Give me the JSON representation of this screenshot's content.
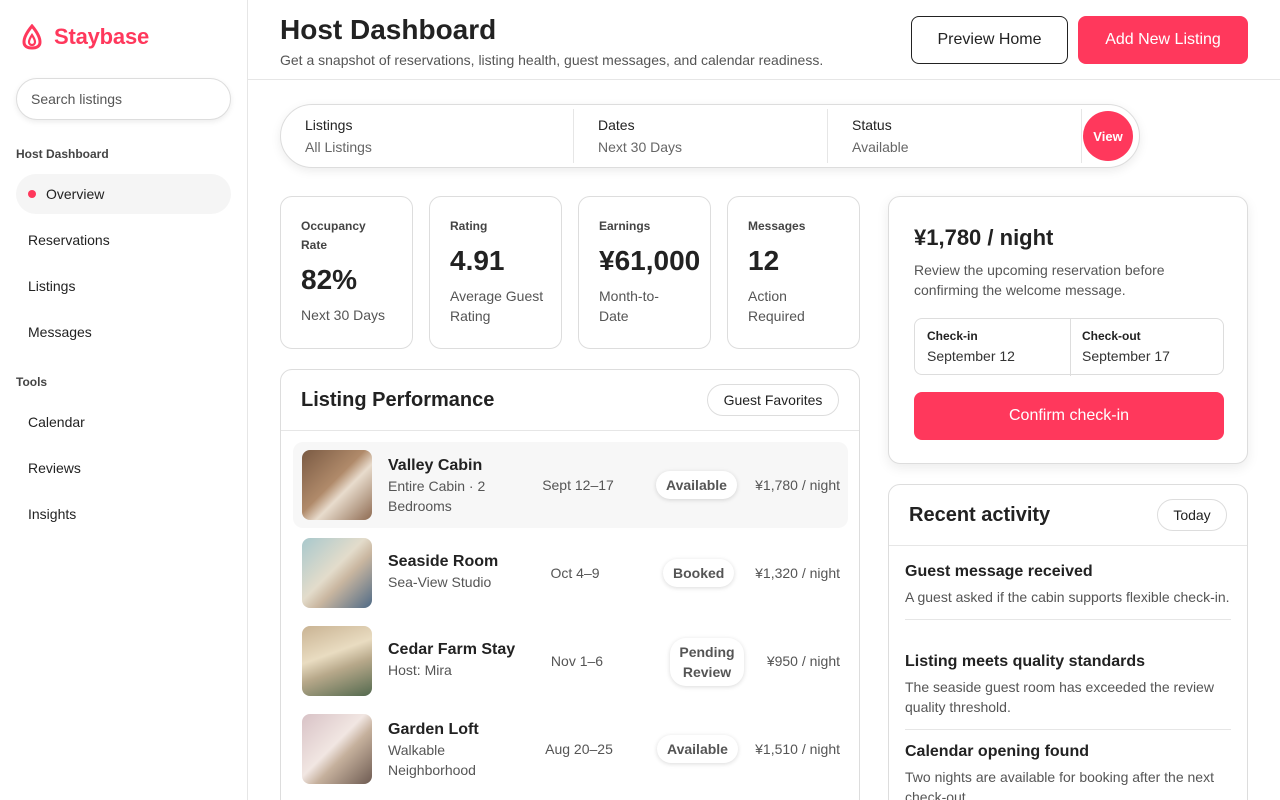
{
  "brand": {
    "name": "Staybase",
    "logo_icon": "staybase-logo-icon",
    "color": "#ff385c"
  },
  "search": {
    "placeholder": "Search listings"
  },
  "sidebar": {
    "sections": [
      {
        "heading": "Host Dashboard",
        "items": [
          {
            "label": "Overview",
            "active": true
          },
          {
            "label": "Reservations"
          },
          {
            "label": "Listings"
          },
          {
            "label": "Messages"
          }
        ]
      },
      {
        "heading": "Tools",
        "items": [
          {
            "label": "Calendar"
          },
          {
            "label": "Reviews"
          },
          {
            "label": "Insights"
          }
        ]
      }
    ]
  },
  "header": {
    "title": "Host Dashboard",
    "subtitle": "Get a snapshot of reservations, listing health, guest messages, and calendar readiness.",
    "preview_label": "Preview Home",
    "add_label": "Add New Listing"
  },
  "filters": {
    "listings": {
      "label": "Listings",
      "value": "All Listings"
    },
    "dates": {
      "label": "Dates",
      "value": "Next 30 Days"
    },
    "status": {
      "label": "Status",
      "value": "Available"
    },
    "view_label": "View"
  },
  "stats": [
    {
      "label": "Occupancy Rate",
      "value": "82%",
      "sub": "Next 30 Days"
    },
    {
      "label": "Rating",
      "value": "4.91",
      "sub": "Average Guest Rating"
    },
    {
      "label": "Earnings",
      "value": "¥61,000",
      "sub": "Month-to-Date"
    },
    {
      "label": "Messages",
      "value": "12",
      "sub": "Action Required"
    }
  ],
  "performance": {
    "title": "Listing Performance",
    "filter_label": "Guest Favorites",
    "listings": [
      {
        "name": "Valley Cabin",
        "sub": "Entire Cabin · 2 Bedrooms",
        "dates": "Sept 12–17",
        "status": "Available",
        "price": "¥1,780 / night"
      },
      {
        "name": "Seaside Room",
        "sub": "Sea-View Studio",
        "dates": "Oct 4–9",
        "status": "Booked",
        "price": "¥1,320 / night"
      },
      {
        "name": "Cedar Farm Stay",
        "sub": "Host: Mira",
        "dates": "Nov 1–6",
        "status": "Pending Review",
        "price": "¥950 / night"
      },
      {
        "name": "Garden Loft",
        "sub": "Walkable Neighborhood",
        "dates": "Aug 20–25",
        "status": "Available",
        "price": "¥1,510 / night"
      }
    ]
  },
  "booking": {
    "price": "¥1,780 / night",
    "description": "Review the upcoming reservation before confirming the welcome message.",
    "checkin_label": "Check-in",
    "checkin_value": "September 12",
    "checkout_label": "Check-out",
    "checkout_value": "September 17",
    "confirm_label": "Confirm check-in"
  },
  "activity": {
    "title": "Recent activity",
    "filter_label": "Today",
    "items": [
      {
        "title": "Guest message received",
        "desc": "A guest asked if the cabin supports flexible check-in."
      },
      {
        "title": "Listing meets quality standards",
        "desc": "The seaside guest room has exceeded the review quality threshold."
      },
      {
        "title": "Calendar opening found",
        "desc": "Two nights are available for booking after the next check-out."
      }
    ]
  }
}
